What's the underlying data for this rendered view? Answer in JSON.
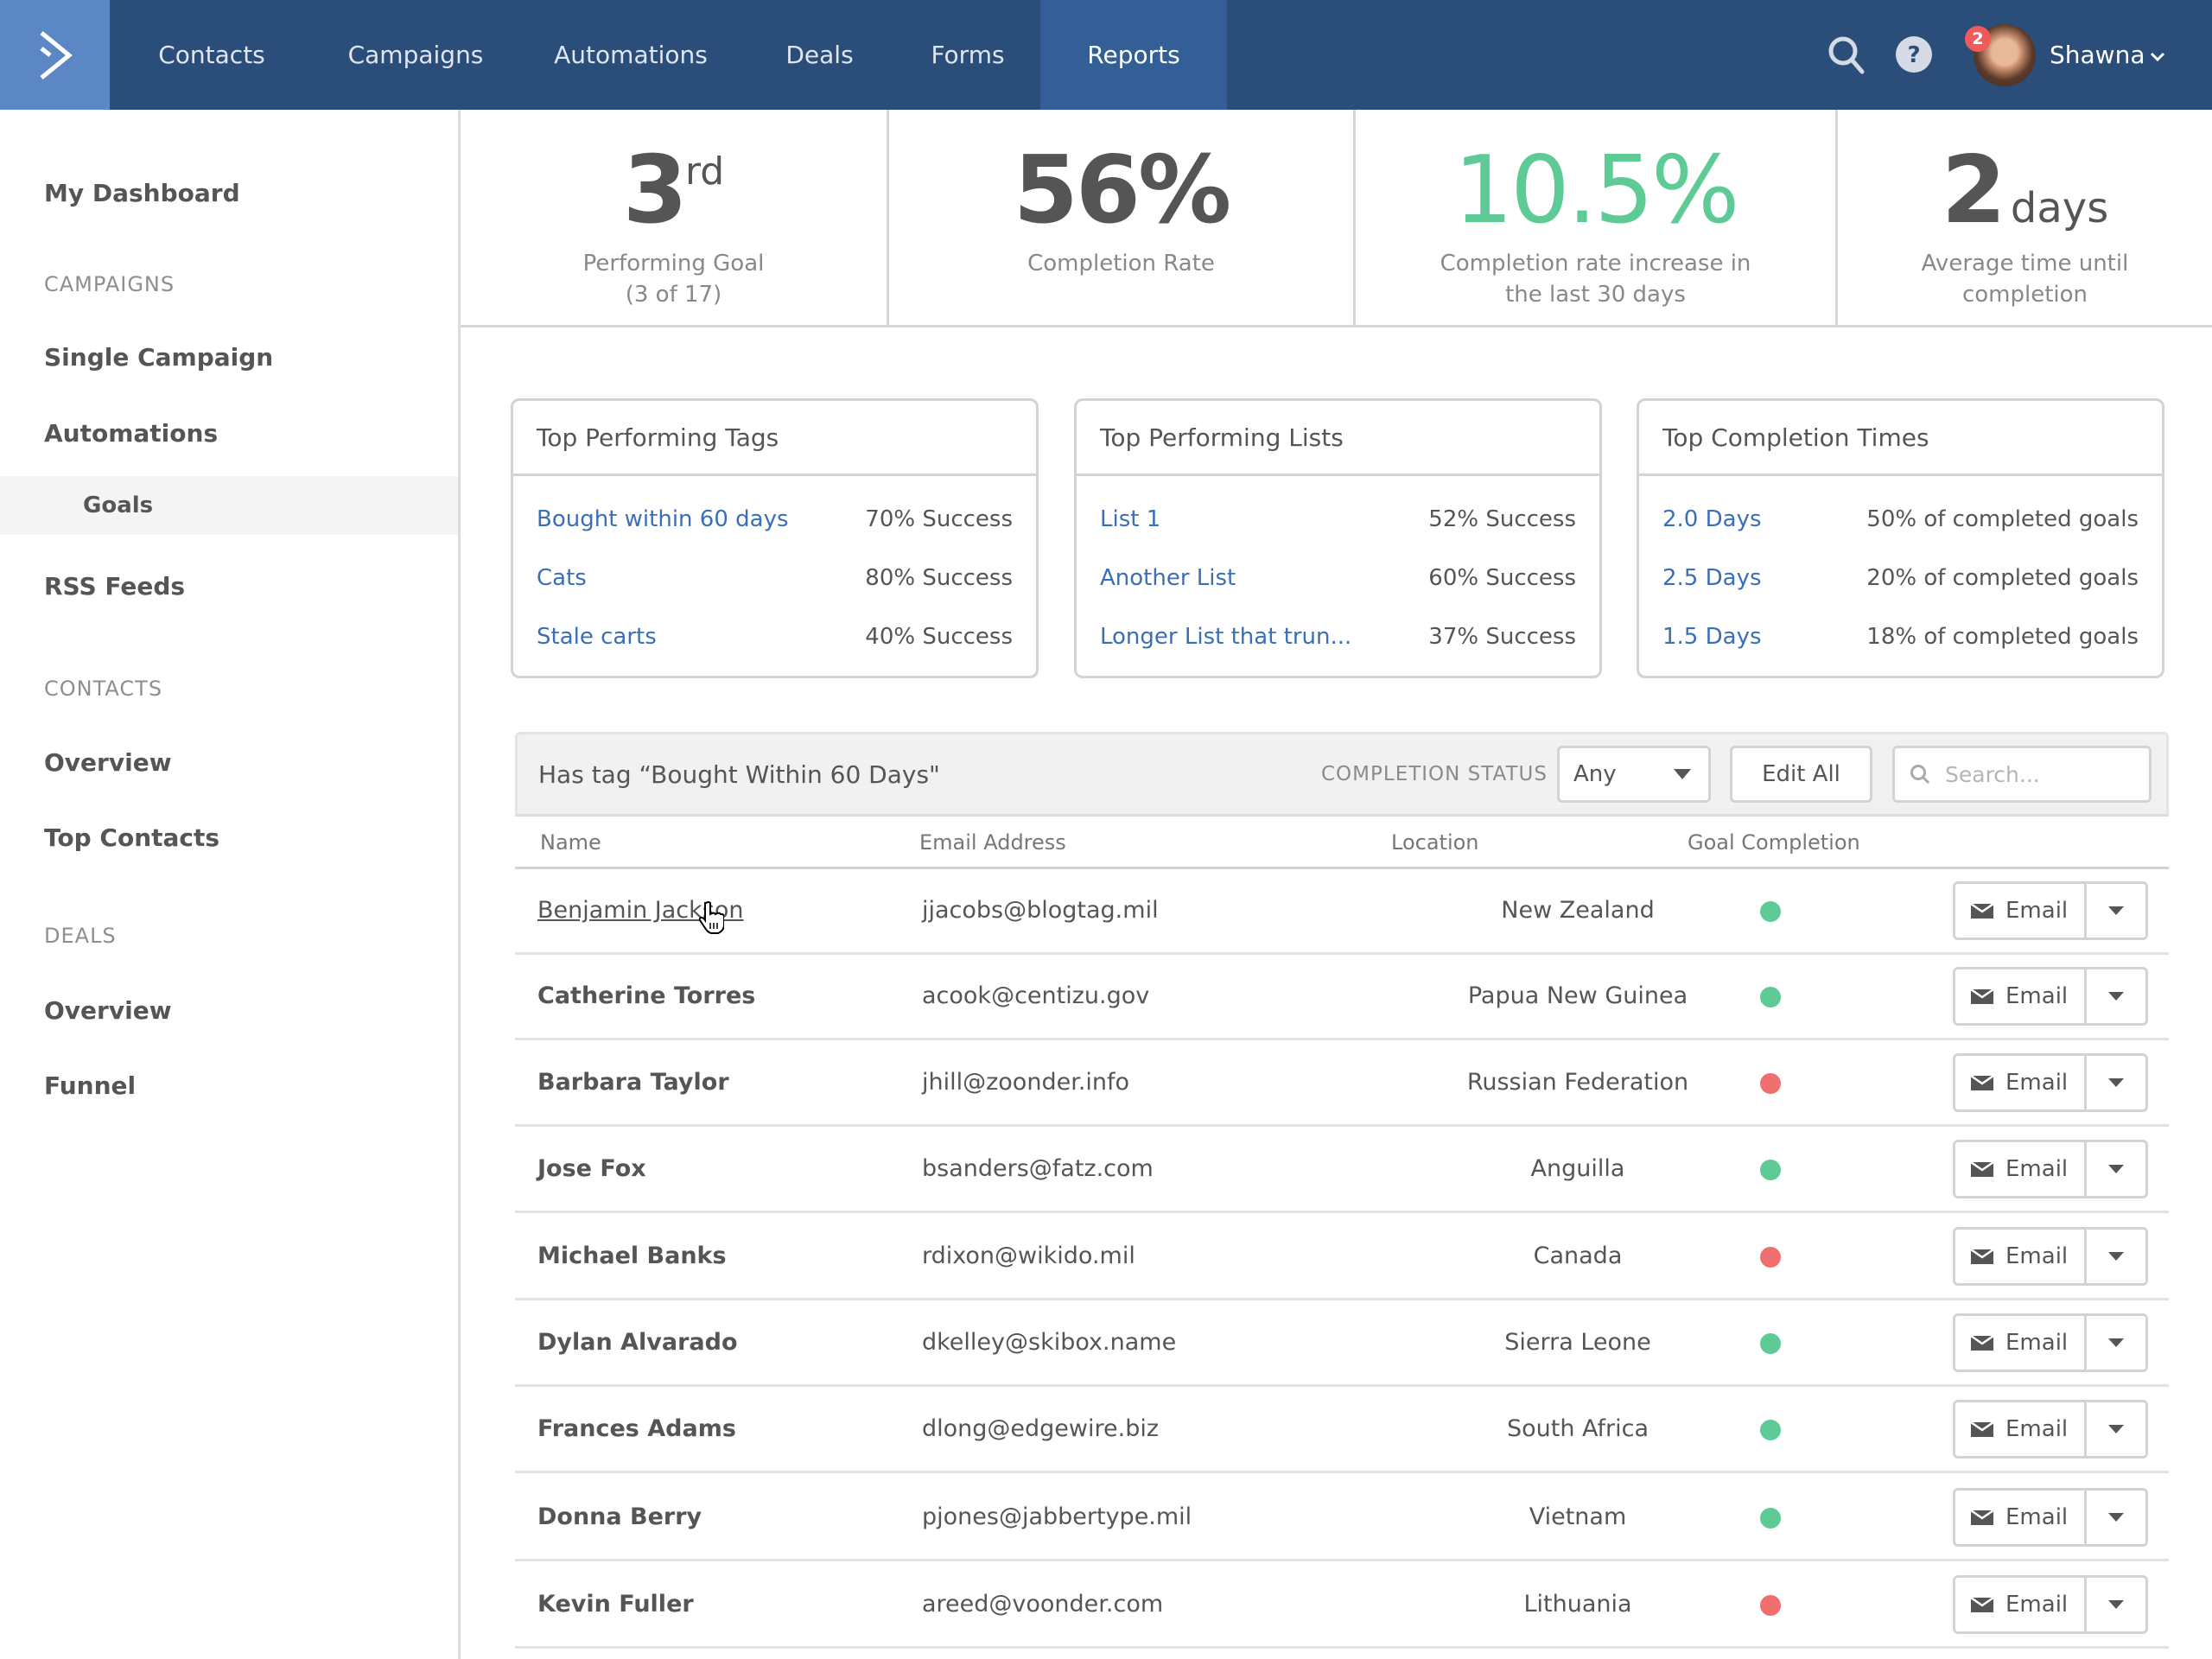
{
  "colors": {
    "nav_bg": "#2a4d7a",
    "nav_active": "#345e96",
    "logo_bg": "#5b87c5",
    "link": "#3a6fb7",
    "success_green": "#5ecb97",
    "fail_red": "#ef6f6f",
    "badge_red": "#f05a5a"
  },
  "topnav": {
    "logo": "activecampaign-chevron-logo",
    "items": [
      {
        "label": "Contacts"
      },
      {
        "label": "Campaigns"
      },
      {
        "label": "Automations"
      },
      {
        "label": "Deals"
      },
      {
        "label": "Forms"
      },
      {
        "label": "Reports",
        "active": true
      }
    ],
    "icons": [
      "search-icon",
      "help-icon"
    ],
    "user": {
      "name": "Shawna",
      "notifications": "2"
    }
  },
  "sidebar": {
    "top": {
      "label": "My Dashboard"
    },
    "sections": [
      {
        "heading": "CAMPAIGNS",
        "items": [
          {
            "label": "Single Campaign"
          },
          {
            "label": "Automations"
          },
          {
            "label": "Goals",
            "sub": true,
            "selected": true
          },
          {
            "label": "RSS Feeds"
          }
        ]
      },
      {
        "heading": "CONTACTS",
        "items": [
          {
            "label": "Overview"
          },
          {
            "label": "Top Contacts"
          }
        ]
      },
      {
        "heading": "DEALS",
        "items": [
          {
            "label": "Overview"
          },
          {
            "label": "Funnel"
          }
        ]
      }
    ]
  },
  "kpis": [
    {
      "value": "3",
      "suffix": "rd",
      "label_line1": "Performing Goal",
      "label_line2": "(3 of 17)"
    },
    {
      "value": "56%",
      "label_line1": "Completion Rate",
      "label_line2": ""
    },
    {
      "value": "10.5%",
      "label_line1": "Completion rate increase in",
      "label_line2": "the last 30 days"
    },
    {
      "value": "2",
      "unit": "days",
      "label_line1": "Average time until",
      "label_line2": "completion"
    }
  ],
  "cards": [
    {
      "title": "Top Performing Tags",
      "rows": [
        {
          "label": "Bought within 60 days",
          "value": "70% Success"
        },
        {
          "label": "Cats",
          "value": "80% Success"
        },
        {
          "label": "Stale carts",
          "value": "40% Success"
        }
      ]
    },
    {
      "title": "Top Performing Lists",
      "rows": [
        {
          "label": "List 1",
          "value": "52% Success"
        },
        {
          "label": "Another List",
          "value": "60% Success"
        },
        {
          "label": "Longer List that trun...",
          "value": "37% Success"
        }
      ]
    },
    {
      "title": "Top Completion Times",
      "rows": [
        {
          "label": "2.0 Days",
          "value": "50% of completed goals"
        },
        {
          "label": "2.5 Days",
          "value": "20% of completed goals"
        },
        {
          "label": "1.5 Days",
          "value": "18% of completed goals"
        }
      ]
    }
  ],
  "table": {
    "title": "Has tag “Bought Within 60 Days\"",
    "completion_status_label": "COMPLETION STATUS",
    "completion_status_value": "Any",
    "edit_all_label": "Edit All",
    "search_placeholder": "Search...",
    "columns": [
      "Name",
      "Email Address",
      "Location",
      "Goal Completion"
    ],
    "action_label": "Email",
    "rows": [
      {
        "name": "Benjamin Jackson",
        "email": "jjacobs@blogtag.mil",
        "location": "New Zealand",
        "completed": true
      },
      {
        "name": "Catherine Torres",
        "email": "acook@centizu.gov",
        "location": "Papua New Guinea",
        "completed": true
      },
      {
        "name": "Barbara Taylor",
        "email": "jhill@zoonder.info",
        "location": "Russian Federation",
        "completed": false
      },
      {
        "name": "Jose Fox",
        "email": "bsanders@fatz.com",
        "location": "Anguilla",
        "completed": true
      },
      {
        "name": "Michael Banks",
        "email": "rdixon@wikido.mil",
        "location": "Canada",
        "completed": false
      },
      {
        "name": "Dylan Alvarado",
        "email": "dkelley@skibox.name",
        "location": "Sierra Leone",
        "completed": true
      },
      {
        "name": "Frances Adams",
        "email": "dlong@edgewire.biz",
        "location": "South Africa",
        "completed": true
      },
      {
        "name": "Donna Berry",
        "email": "pjones@jabbertype.mil",
        "location": "Vietnam",
        "completed": true
      },
      {
        "name": "Kevin Fuller",
        "email": "areed@voonder.com",
        "location": "Lithuania",
        "completed": false
      }
    ]
  }
}
